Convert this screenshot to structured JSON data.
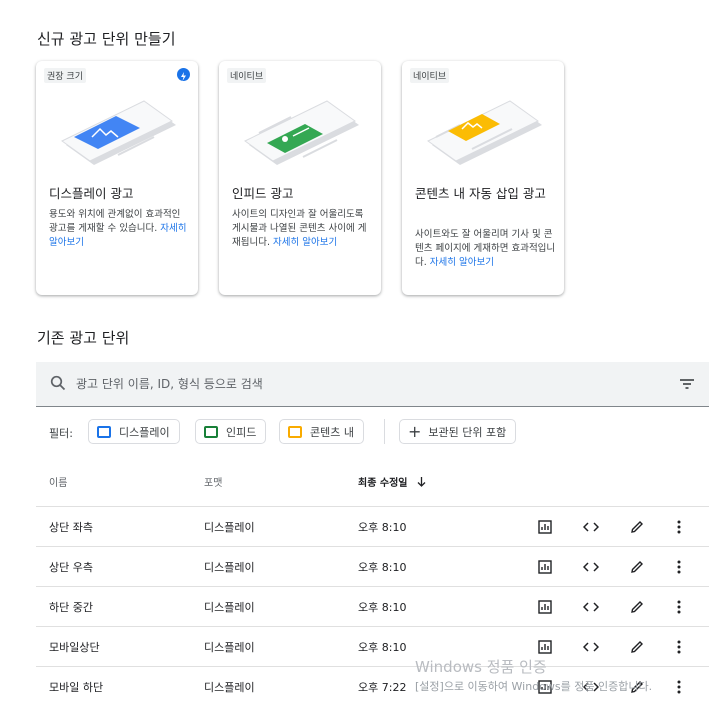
{
  "new_section": {
    "title": "신규 광고 단위 만들기"
  },
  "cards": [
    {
      "badge": "권장 크기",
      "has_bolt": true,
      "title": "디스플레이 광고",
      "desc": "용도와 위치에 관계없이 효과적인 광고를 게재할 수 있습니다.",
      "link": "자세히 알아보기",
      "accent": "#4285f4"
    },
    {
      "badge": "네이티브",
      "has_bolt": false,
      "title": "인피드 광고",
      "desc": "사이트의 디자인과 잘 어울리도록 게시물과 나열된 콘텐츠 사이에 게재됩니다.",
      "link": "자세히 알아보기",
      "accent": "#34a853"
    },
    {
      "badge": "네이티브",
      "has_bolt": false,
      "title": "콘텐츠 내 자동 삽입 광고",
      "desc": "사이트와도 잘 어울리며 기사 및 콘텐츠 페이지에 게재하면 효과적입니다.",
      "link": "자세히 알아보기",
      "accent": "#fbbc04"
    }
  ],
  "existing_section": {
    "title": "기존 광고 단위"
  },
  "search": {
    "placeholder": "광고 단위 이름, ID, 형식 등으로 검색",
    "icon": "search-icon",
    "filter_icon": "filter-list-icon"
  },
  "filters": {
    "label": "필터:",
    "chips": [
      {
        "label": "디스플레이",
        "color": "#1a73e8"
      },
      {
        "label": "인피드",
        "color": "#188038"
      },
      {
        "label": "콘텐츠 내",
        "color": "#f9ab00"
      }
    ],
    "archived": "보관된 단위 포함"
  },
  "table": {
    "headers": {
      "name": "이름",
      "format": "포맷",
      "modified": "최종 수정일",
      "sort_icon": "arrow-down-icon"
    },
    "rows": [
      {
        "name": "상단 좌측",
        "format": "디스플레이",
        "modified": "오후 8:10"
      },
      {
        "name": "상단 우측",
        "format": "디스플레이",
        "modified": "오후 8:10"
      },
      {
        "name": "하단 중간",
        "format": "디스플레이",
        "modified": "오후 8:10"
      },
      {
        "name": "모바일상단",
        "format": "디스플레이",
        "modified": "오후 8:10"
      },
      {
        "name": "모바일 하단",
        "format": "디스플레이",
        "modified": "오후 7:22"
      }
    ],
    "row_actions": [
      "report-icon",
      "code-icon",
      "edit-icon",
      "more-vert-icon"
    ]
  },
  "watermark": {
    "line1": "Windows 정품 인증",
    "line2": "[설정]으로 이동하여 Windows를 정품 인증합니다."
  }
}
